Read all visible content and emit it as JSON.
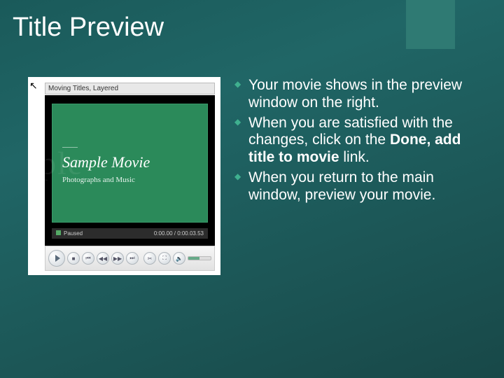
{
  "slide": {
    "title": "Title Preview"
  },
  "preview": {
    "window_label": "Moving Titles, Layered",
    "movie_title": "Sample Movie",
    "movie_subtitle": "Photographs and Music",
    "watermark": "ple",
    "status_label": "Paused",
    "timecode": "0:00.00 / 0:00.03.53"
  },
  "bullets": {
    "b1a": "Your movie shows in the preview window on the right.",
    "b2a": "When you are satisfied with the changes, click on the ",
    "b2b": "Done, add title to movie",
    "b2c": " link.",
    "b3a": "When you return to the main window, preview your movie."
  }
}
